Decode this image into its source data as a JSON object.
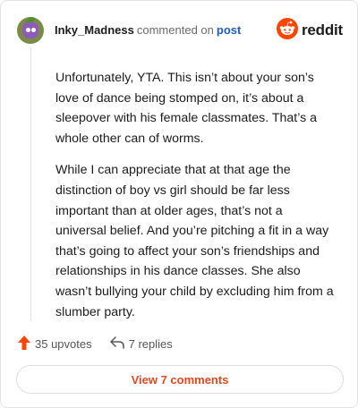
{
  "header": {
    "username": "Inky_Madness",
    "action_text": "commented on",
    "target_text": "post",
    "brand_name": "reddit"
  },
  "comment": {
    "paragraphs": [
      "Unfortunately, YTA. This isn’t about your son’s love of dance being stomped on, it’s about a sleepover with his female classmates. That’s a whole other can of worms.",
      "While I can appreciate that at that age the distinction of boy vs girl should be far less important than at older ages, that’s not a universal belief. And you’re pitching a fit in a way that’s going to affect your son’s friendships and relationships in his dance classes. She also wasn’t bullying your child by excluding him from a slumber party."
    ]
  },
  "actions": {
    "upvotes_label": "35 upvotes",
    "replies_label": "7 replies"
  },
  "footer": {
    "view_comments_label": "View 7 comments"
  },
  "colors": {
    "brand_orange": "#ff4500",
    "link_blue": "#1e5fb4",
    "view_button_text": "#e0491d"
  },
  "icons": [
    "avatar",
    "reddit-logo-icon",
    "upvote-arrow-icon",
    "reply-arrow-icon"
  ]
}
